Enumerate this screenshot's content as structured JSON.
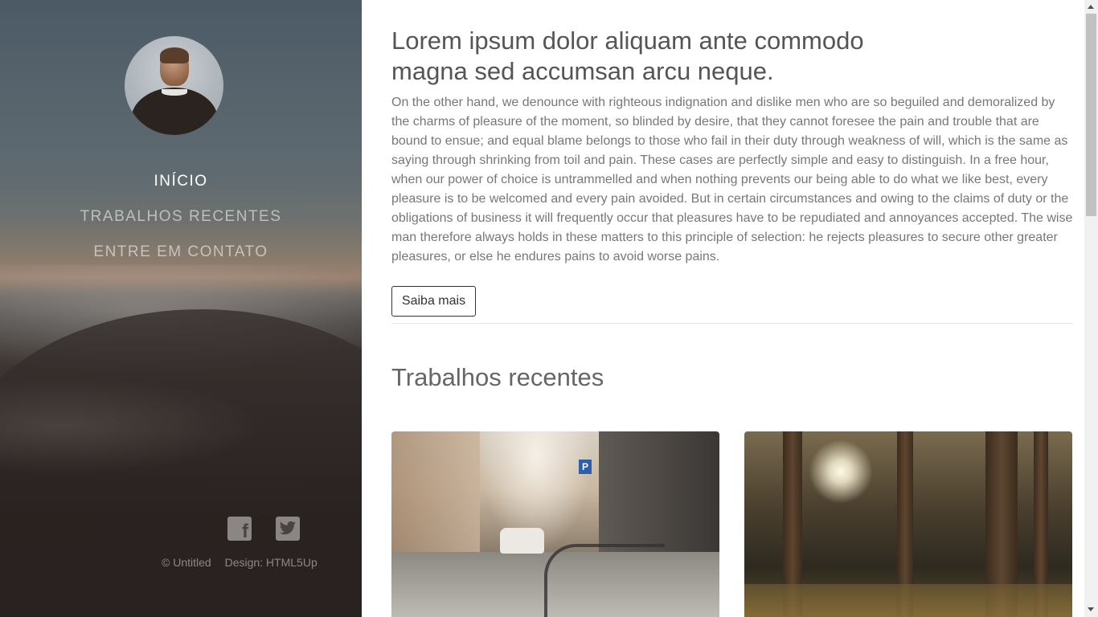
{
  "sidebar": {
    "nav": [
      {
        "label": "INÍCIO",
        "active": true
      },
      {
        "label": "TRABALHOS RECENTES",
        "active": false
      },
      {
        "label": "ENTRE EM CONTATO",
        "active": false
      }
    ],
    "social": [
      "facebook-icon",
      "twitter-icon"
    ],
    "footer": {
      "copyright": "© Untitled",
      "design": "Design: HTML5Up"
    }
  },
  "main": {
    "title": "Lorem ipsum dolor aliquam ante commodo magna sed accumsan arcu neque.",
    "intro": "On the other hand, we denounce with righteous indignation and dislike men who are so beguiled and demoralized by the charms of pleasure of the moment, so blinded by desire, that they cannot foresee the pain and trouble that are bound to ensue; and equal blame belongs to those who fail in their duty through weakness of will, which is the same as saying through shrinking from toil and pain. These cases are perfectly simple and easy to distinguish. In a free hour, when our power of choice is untrammelled and when nothing prevents our being able to do what we like best, every pleasure is to be welcomed and every pain avoided. But in certain circumstances and owing to the claims of duty or the obligations of business it will frequently occur that pleasures have to be repudiated and annoyances accepted. The wise man therefore always holds in these matters to this principle of selection: he rejects pleasures to secure other greater pleasures, or else he endures pains to avoid worse pains.",
    "button_label": "Saiba mais",
    "section_title": "Trabalhos recentes",
    "thumbnails": [
      {
        "name": "street-photo"
      },
      {
        "name": "forest-photo"
      }
    ]
  }
}
